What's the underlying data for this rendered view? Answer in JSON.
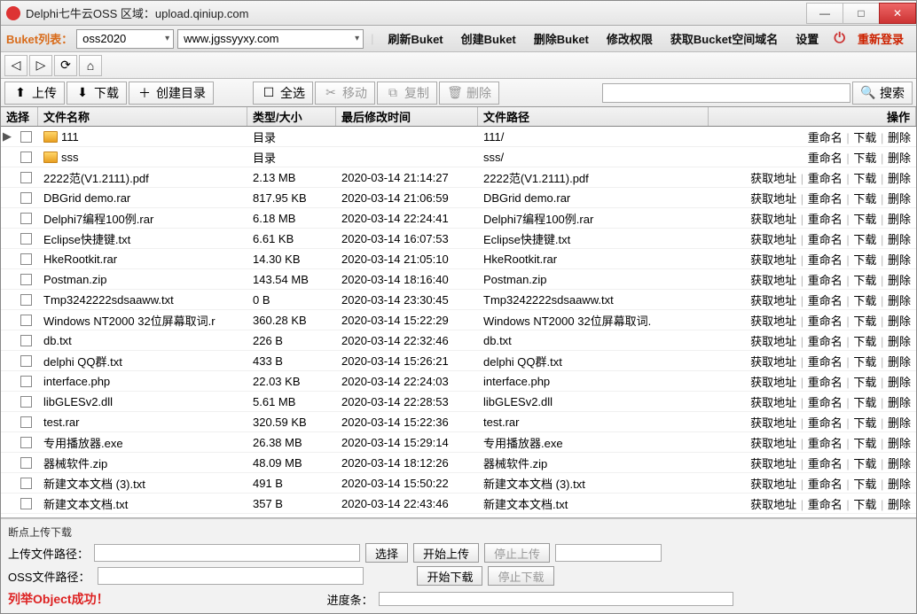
{
  "window": {
    "title": "Delphi七牛云OSS       区域：upload.qiniup.com"
  },
  "toolbar1": {
    "bucket_list_label": "Buket列表：",
    "bucket_value": "oss2020",
    "domain_value": "www.jgssyyxy.com",
    "refresh": "刷新Buket",
    "create": "创建Buket",
    "delete": "删除Buket",
    "perm": "修改权限",
    "get_domain": "获取Bucket空间域名",
    "settings": "设置",
    "relogin": "重新登录"
  },
  "toolbar3": {
    "upload": "上传",
    "download": "下载",
    "mkdir": "创建目录",
    "select_all": "全选",
    "move": "移动",
    "copy": "复制",
    "delete": "删除",
    "search": "搜索"
  },
  "columns": {
    "sel": "选择",
    "name": "文件名称",
    "size": "类型/大小",
    "time": "最后修改时间",
    "path": "文件路径",
    "ops": "操作"
  },
  "ops": {
    "rename": "重命名",
    "download": "下载",
    "delete": "删除",
    "geturl": "获取地址"
  },
  "rows": [
    {
      "folder": true,
      "handle": "▶",
      "name": "111",
      "size": "目录",
      "time": "",
      "path": "111/",
      "ops": [
        "rename",
        "download",
        "delete"
      ]
    },
    {
      "folder": true,
      "name": "sss",
      "size": "目录",
      "time": "",
      "path": "sss/",
      "ops": [
        "rename",
        "download",
        "delete"
      ]
    },
    {
      "name": "2222范(V1.2111).pdf",
      "size": "2.13 MB",
      "time": "2020-03-14 21:14:27",
      "path": "2222范(V1.2111).pdf",
      "ops": [
        "geturl",
        "rename",
        "download",
        "delete"
      ]
    },
    {
      "name": "DBGrid demo.rar",
      "size": "817.95 KB",
      "time": "2020-03-14 21:06:59",
      "path": "DBGrid demo.rar",
      "ops": [
        "geturl",
        "rename",
        "download",
        "delete"
      ]
    },
    {
      "name": "Delphi7编程100例.rar",
      "size": "6.18 MB",
      "time": "2020-03-14 22:24:41",
      "path": "Delphi7编程100例.rar",
      "ops": [
        "geturl",
        "rename",
        "download",
        "delete"
      ]
    },
    {
      "name": "Eclipse快捷键.txt",
      "size": "6.61 KB",
      "time": "2020-03-14 16:07:53",
      "path": "Eclipse快捷键.txt",
      "ops": [
        "geturl",
        "rename",
        "download",
        "delete"
      ]
    },
    {
      "name": "HkeRootkit.rar",
      "size": "14.30 KB",
      "time": "2020-03-14 21:05:10",
      "path": "HkeRootkit.rar",
      "ops": [
        "geturl",
        "rename",
        "download",
        "delete"
      ]
    },
    {
      "name": "Postman.zip",
      "size": "143.54 MB",
      "time": "2020-03-14 18:16:40",
      "path": "Postman.zip",
      "ops": [
        "geturl",
        "rename",
        "download",
        "delete"
      ]
    },
    {
      "name": "Tmp3242222sdsaaww.txt",
      "size": "0 B",
      "time": "2020-03-14 23:30:45",
      "path": "Tmp3242222sdsaaww.txt",
      "ops": [
        "geturl",
        "rename",
        "download",
        "delete"
      ]
    },
    {
      "name": "Windows NT2000 32位屏幕取词.r",
      "size": "360.28 KB",
      "time": "2020-03-14 15:22:29",
      "path": "Windows NT2000 32位屏幕取词.",
      "ops": [
        "geturl",
        "rename",
        "download",
        "delete"
      ]
    },
    {
      "name": "db.txt",
      "size": "226 B",
      "time": "2020-03-14 22:32:46",
      "path": "db.txt",
      "ops": [
        "geturl",
        "rename",
        "download",
        "delete"
      ]
    },
    {
      "name": "delphi QQ群.txt",
      "size": "433 B",
      "time": "2020-03-14 15:26:21",
      "path": "delphi QQ群.txt",
      "ops": [
        "geturl",
        "rename",
        "download",
        "delete"
      ]
    },
    {
      "name": "interface.php",
      "size": "22.03 KB",
      "time": "2020-03-14 22:24:03",
      "path": "interface.php",
      "ops": [
        "geturl",
        "rename",
        "download",
        "delete"
      ]
    },
    {
      "name": "libGLESv2.dll",
      "size": "5.61 MB",
      "time": "2020-03-14 22:28:53",
      "path": "libGLESv2.dll",
      "ops": [
        "geturl",
        "rename",
        "download",
        "delete"
      ]
    },
    {
      "name": "test.rar",
      "size": "320.59 KB",
      "time": "2020-03-14 15:22:36",
      "path": "test.rar",
      "ops": [
        "geturl",
        "rename",
        "download",
        "delete"
      ]
    },
    {
      "name": "专用播放器.exe",
      "size": "26.38 MB",
      "time": "2020-03-14 15:29:14",
      "path": "专用播放器.exe",
      "ops": [
        "geturl",
        "rename",
        "download",
        "delete"
      ]
    },
    {
      "name": "器械软件.zip",
      "size": "48.09 MB",
      "time": "2020-03-14 18:12:26",
      "path": "器械软件.zip",
      "ops": [
        "geturl",
        "rename",
        "download",
        "delete"
      ]
    },
    {
      "name": "新建文本文档 (3).txt",
      "size": "491 B",
      "time": "2020-03-14 15:50:22",
      "path": "新建文本文档 (3).txt",
      "ops": [
        "geturl",
        "rename",
        "download",
        "delete"
      ]
    },
    {
      "name": "新建文本文档.txt",
      "size": "357 B",
      "time": "2020-03-14 22:43:46",
      "path": "新建文本文档.txt",
      "ops": [
        "geturl",
        "rename",
        "download",
        "delete"
      ]
    }
  ],
  "bottom": {
    "group": "断点上传下载",
    "upload_path_label": "上传文件路径：",
    "oss_path_label": "OSS文件路径：",
    "choose": "选择",
    "start_upload": "开始上传",
    "stop_upload": "停止上传",
    "start_download": "开始下载",
    "stop_download": "停止下载",
    "status": "列举Object成功！",
    "progress_label": "进度条："
  }
}
